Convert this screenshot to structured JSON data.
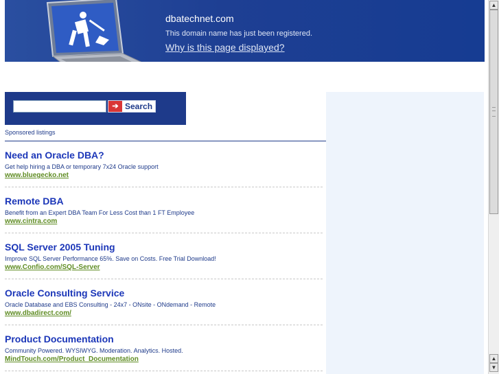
{
  "header": {
    "domain": "dbatechnet.com",
    "registered_text": "This domain name has just been registered.",
    "why_link": "Why is this page displayed?"
  },
  "search": {
    "value": "",
    "button_label": "Search",
    "button_icon": "arrow-right-icon"
  },
  "sponsored_label": "Sponsored listings",
  "listings": [
    {
      "title": "Need an Oracle DBA?",
      "desc": "Get help hiring a DBA or temporary 7x24 Oracle support",
      "url": "www.bluegecko.net"
    },
    {
      "title": "Remote DBA",
      "desc": "Benefit from an Expert DBA Team For Less Cost than 1 FT Employee",
      "url": "www.cintra.com"
    },
    {
      "title": "SQL Server 2005 Tuning",
      "desc": "Improve SQL Server Performance 65%. Save on Costs. Free Trial Download!",
      "url": "www.Confio.com/SQL-Server"
    },
    {
      "title": "Oracle Consulting Service",
      "desc": "Oracle Database and EBS Consulting - 24x7 - ONsite - ONdemand - Remote",
      "url": "www.dbadirect.com/"
    },
    {
      "title": "Product Documentation",
      "desc": "Community Powered. WYSIWYG. Moderation. Analytics. Hosted.",
      "url": "MindTouch.com/Product_Documentation"
    }
  ],
  "colors": {
    "header_blue": "#1e3f93",
    "title_blue": "#1b36b8",
    "url_green": "#5f8c23",
    "panel_bg": "#eef4fc"
  },
  "scrollbar": {
    "up_icon": "chevron-up-icon",
    "down_icon": "chevron-down-icon"
  }
}
